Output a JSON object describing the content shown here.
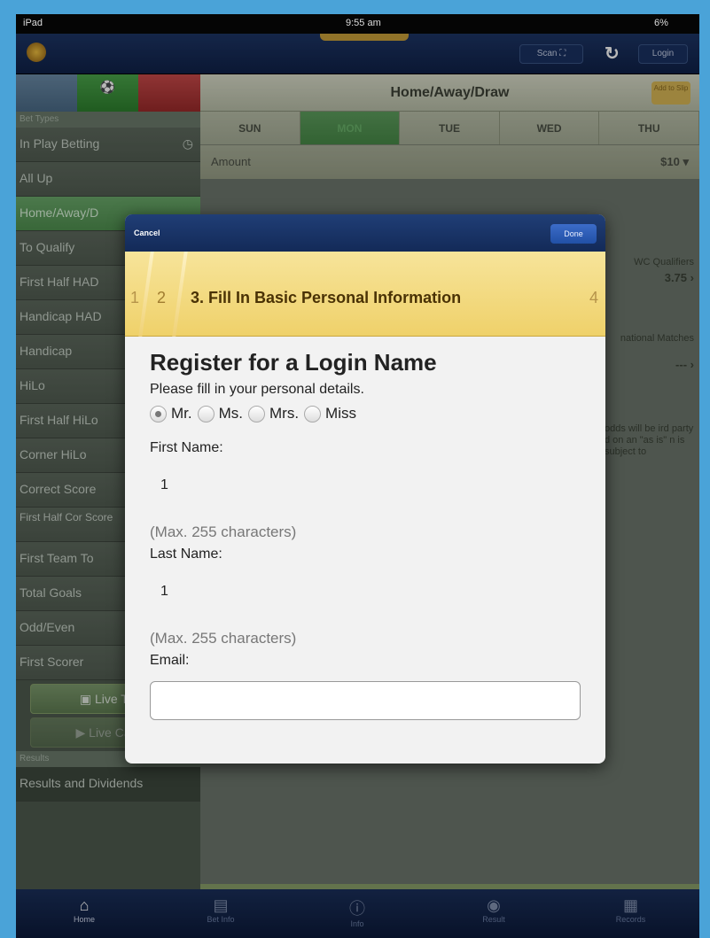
{
  "status": {
    "device": "iPad",
    "time": "9:55 am",
    "battery": "6%"
  },
  "topbar": {
    "app_title": "",
    "scan_label": "Scan",
    "login_label": "Login"
  },
  "sidebar": {
    "header_bet_types": "Bet Types",
    "items": [
      {
        "label": "In Play Betting"
      },
      {
        "label": "All Up"
      },
      {
        "label": "Home/Away/D",
        "active": true
      },
      {
        "label": "To Qualify"
      },
      {
        "label": "First Half HAD"
      },
      {
        "label": "Handicap HAD"
      },
      {
        "label": "Handicap"
      },
      {
        "label": "HiLo"
      },
      {
        "label": "First Half HiLo"
      },
      {
        "label": "Corner HiLo"
      },
      {
        "label": "Correct Score"
      },
      {
        "label": "First Half Cor Score"
      },
      {
        "label": "First Team To"
      },
      {
        "label": "Total Goals"
      },
      {
        "label": "Odd/Even"
      },
      {
        "label": "First Scorer"
      }
    ],
    "live_tv": "Live TV",
    "live_cast": "Live Cast",
    "header_results": "Results",
    "results_and_dividends": "Results and Dividends"
  },
  "main": {
    "title": "Home/Away/Draw",
    "bet_button": "Add to Slip",
    "days": [
      "SUN",
      "MON",
      "TUE",
      "WED",
      "THU"
    ],
    "selected_day": "MON",
    "amount_label": "Amount",
    "amount_value": "$10",
    "match1_league": "WC Qualifiers",
    "match1_odds": "3.75",
    "match2_league": "national Matches",
    "match2_odds": "---",
    "info_text": "odds will be ird party d on an \"as is\" n is subject to"
  },
  "modal": {
    "cancel_label": "Cancel",
    "done_label": "Done",
    "step_prev1": "1",
    "step_prev2": "2",
    "step_current": "3. Fill In Basic Personal Information",
    "step_next": "4",
    "heading": "Register for a Login Name",
    "subheading": "Please fill in your personal details.",
    "titles": [
      {
        "label": "Mr.",
        "selected": true
      },
      {
        "label": "Ms.",
        "selected": false
      },
      {
        "label": "Mrs.",
        "selected": false
      },
      {
        "label": "Miss",
        "selected": false
      }
    ],
    "first_name_label": "First Name:",
    "first_name_value": "1",
    "first_name_hint": "(Max. 255 characters)",
    "last_name_label": "Last Name:",
    "last_name_value": "1",
    "last_name_hint": "(Max. 255 characters)",
    "email_label": "Email:",
    "email_value": ""
  },
  "tabbar": {
    "tabs": [
      {
        "label": "Home",
        "icon": "home-icon"
      },
      {
        "label": "Bet Info",
        "icon": "basket-icon"
      },
      {
        "label": "Info",
        "icon": "info-icon"
      },
      {
        "label": "Result",
        "icon": "result-icon"
      },
      {
        "label": "Records",
        "icon": "records-icon"
      }
    ]
  }
}
